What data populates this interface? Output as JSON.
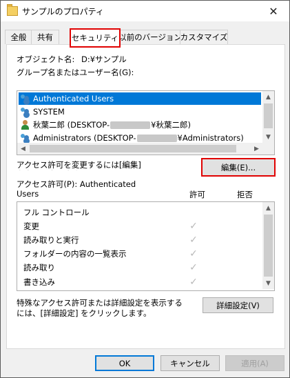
{
  "window": {
    "title": "サンプルのプロパティ"
  },
  "tabs": [
    {
      "label": "全般"
    },
    {
      "label": "共有"
    },
    {
      "label": "セキュリティ"
    },
    {
      "label": "以前のバージョン"
    },
    {
      "label": "カスタマイズ"
    }
  ],
  "object": {
    "label": "オブジェクト名:",
    "value": "D:¥サンプル"
  },
  "group_label": "グループ名またはユーザー名(G):",
  "users": [
    {
      "name": "Authenticated Users",
      "icon": "group-icon"
    },
    {
      "name": "SYSTEM",
      "icon": "group-icon"
    },
    {
      "prefix": "秋葉二郎 (DESKTOP-",
      "suffix": "¥秋葉二郎)",
      "icon": "user-icon"
    },
    {
      "prefix": "Administrators (DESKTOP-",
      "suffix": "¥Administrators)",
      "icon": "group-icon"
    }
  ],
  "edit": {
    "note": "アクセス許可を変更するには[編集]をクリックします。",
    "button": "編集(E)..."
  },
  "perm": {
    "label_line1": "アクセス許可(P): Authenticated",
    "label_line2": "Users",
    "allow": "許可",
    "deny": "拒否",
    "items": [
      {
        "name": "フル コントロール",
        "allow": false
      },
      {
        "name": "変更",
        "allow": true
      },
      {
        "name": "読み取りと実行",
        "allow": true
      },
      {
        "name": "フォルダーの内容の一覧表示",
        "allow": true
      },
      {
        "name": "読み取り",
        "allow": true
      },
      {
        "name": "書き込み",
        "allow": true
      }
    ]
  },
  "advanced": {
    "note_line1": "特殊なアクセス許可または詳細設定を表示する",
    "note_line2": "には、[詳細設定] をクリックします。",
    "button": "詳細設定(V)"
  },
  "footer": {
    "ok": "OK",
    "cancel": "キャンセル",
    "apply": "適用(A)"
  },
  "colors": {
    "accent": "#0078d7",
    "highlight": "#e00000"
  }
}
